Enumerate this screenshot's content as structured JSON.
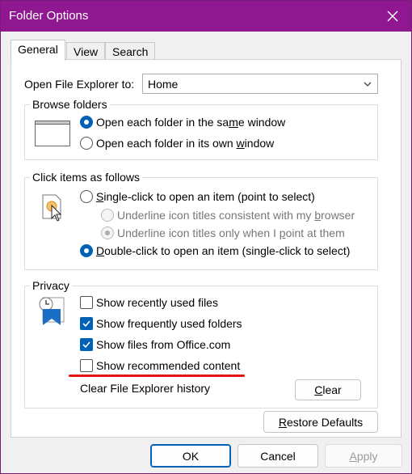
{
  "window": {
    "title": "Folder Options"
  },
  "tabs": [
    {
      "label": "General"
    },
    {
      "label": "View"
    },
    {
      "label": "Search"
    }
  ],
  "general": {
    "open_label": "Open File Explorer to:",
    "open_value": "Home",
    "browse": {
      "title": "Browse folders",
      "same_window_pre": "Open each folder in the sa",
      "same_window_key": "m",
      "same_window_post": "e window",
      "own_window_pre": "Open each folder in its own ",
      "own_window_key": "w",
      "own_window_post": "indow"
    },
    "click": {
      "title": "Click items as follows",
      "single_key": "S",
      "single_rest": "ingle-click to open an item (point to select)",
      "underline_browser_pre": "Underline icon titles consistent with my ",
      "underline_browser_key": "b",
      "underline_browser_post": "rowser",
      "underline_point_pre": "Underline icon titles only when I ",
      "underline_point_key": "p",
      "underline_point_post": "oint at them",
      "double_key": "D",
      "double_rest": "ouble-click to open an item (single-click to select)"
    },
    "privacy": {
      "title": "Privacy",
      "recent": "Show recently used files",
      "frequent": "Show frequently used folders",
      "office": "Show files from Office.com",
      "recommended": "Show recommended content",
      "clear_label": "Clear File Explorer history",
      "clear_button_key": "C",
      "clear_button_rest": "lear"
    },
    "restore_key": "R",
    "restore_rest": "estore Defaults"
  },
  "footer": {
    "ok": "OK",
    "cancel": "Cancel",
    "apply_key": "A",
    "apply_rest": "pply"
  },
  "colors": {
    "titlebar": "#8f178f",
    "accent": "#0062b6",
    "annotation": "#e31414"
  },
  "state": {
    "browse_selected": "same_window",
    "click_selected": "double_click",
    "underline_selected": "point",
    "show_recent": false,
    "show_frequent": true,
    "show_office": true,
    "show_recommended": false
  }
}
